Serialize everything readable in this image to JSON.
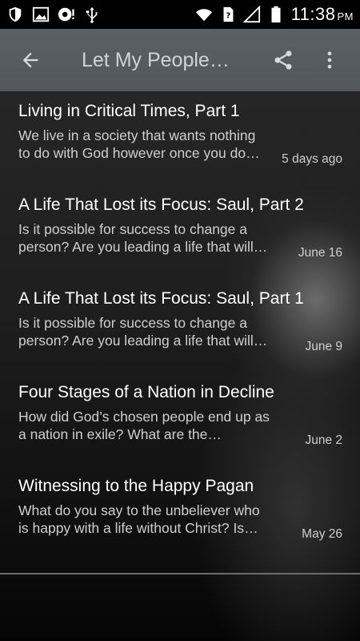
{
  "status_bar": {
    "time": "11:38",
    "ampm": "PM",
    "icons": [
      "shield-icon",
      "image-icon",
      "notification-icon",
      "usb-icon",
      "wifi-icon",
      "sim-icon",
      "signal-icon",
      "battery-icon"
    ]
  },
  "app_bar": {
    "title": "Let My People…",
    "icons": [
      "back-arrow-icon",
      "share-icon",
      "more-vert-icon"
    ],
    "background": "#5b6066"
  },
  "items": [
    {
      "title": "Living in Critical Times, Part 1",
      "desc_line1": "We live in a society that wants nothing",
      "desc_line2": "to do with God however once you do…",
      "date": "5 days ago"
    },
    {
      "title": "A Life That Lost its Focus: Saul, Part 2",
      "desc_line1": "Is it possible for success to change a",
      "desc_line2": "person? Are you leading a life that will…",
      "date": "June 16"
    },
    {
      "title": "A Life That Lost its Focus: Saul, Part 1",
      "desc_line1": "Is it possible for success to change a",
      "desc_line2": "person? Are you leading a life that will…",
      "date": "June 9"
    },
    {
      "title": "Four Stages of a Nation in Decline",
      "desc_line1": "How did God’s chosen people end up as",
      "desc_line2": "a nation in exile? What are the…",
      "date": "June 2"
    },
    {
      "title": "Witnessing to the Happy Pagan",
      "desc_line1": "What do you say to the unbeliever who",
      "desc_line2": "is happy with a life without Christ? Is…",
      "date": "May 26"
    }
  ]
}
